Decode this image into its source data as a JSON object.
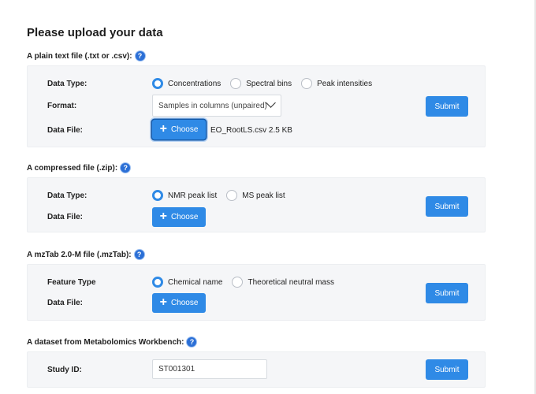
{
  "page": {
    "title": "Please upload your data"
  },
  "plain_text": {
    "heading": "A plain text file (.txt or .csv):",
    "data_type_label": "Data Type:",
    "data_type_options": [
      "Concentrations",
      "Spectral bins",
      "Peak intensities"
    ],
    "data_type_selected": "Concentrations",
    "format_label": "Format:",
    "format_value": "Samples in columns (unpaired)",
    "data_file_label": "Data File:",
    "choose_label": "Choose",
    "file_info": "EO_RootLS.csv 2.5 KB",
    "submit_label": "Submit"
  },
  "compressed": {
    "heading": "A compressed file (.zip):",
    "data_type_label": "Data Type:",
    "data_type_options": [
      "NMR peak list",
      "MS peak list"
    ],
    "data_type_selected": "NMR peak list",
    "data_file_label": "Data File:",
    "choose_label": "Choose",
    "submit_label": "Submit"
  },
  "mztab": {
    "heading": "A mzTab 2.0-M file (.mzTab):",
    "feature_type_label": "Feature Type",
    "feature_type_options": [
      "Chemical name",
      "Theoretical neutral mass"
    ],
    "feature_type_selected": "Chemical name",
    "data_file_label": "Data File:",
    "choose_label": "Choose",
    "submit_label": "Submit"
  },
  "workbench": {
    "heading": "A dataset from Metabolomics Workbench:",
    "study_id_label": "Study ID:",
    "study_id_value": "ST001301",
    "submit_label": "Submit"
  },
  "icons": {
    "help": "question-circle-icon",
    "plus": "plus-icon",
    "chevron": "chevron-down-icon"
  },
  "colors": {
    "primary": "#2f8ae6",
    "help": "#2b6fd6",
    "panel": "#f5f6f8"
  }
}
